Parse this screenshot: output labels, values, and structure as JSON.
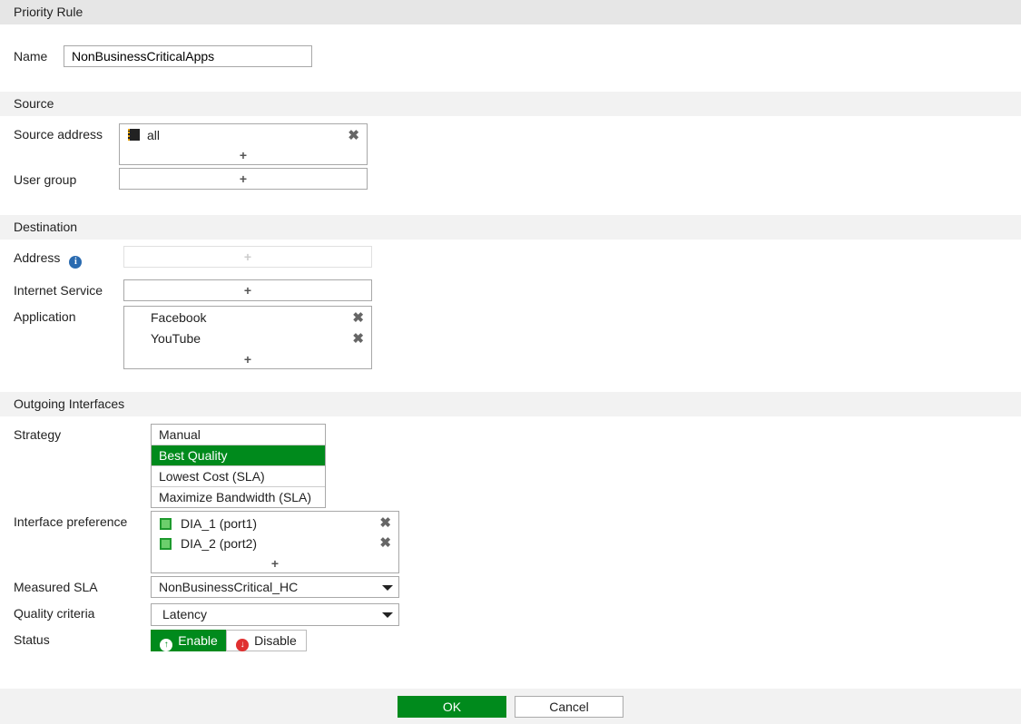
{
  "title": "Priority Rule",
  "name": {
    "label": "Name",
    "value": "NonBusinessCriticalApps"
  },
  "source": {
    "header": "Source",
    "address_label": "Source address",
    "address_items": [
      "all"
    ],
    "user_group_label": "User group"
  },
  "destination": {
    "header": "Destination",
    "address_label": "Address",
    "internet_service_label": "Internet Service",
    "application_label": "Application",
    "applications": [
      "Facebook",
      "YouTube"
    ]
  },
  "outgoing": {
    "header": "Outgoing Interfaces",
    "strategy_label": "Strategy",
    "strategies": [
      "Manual",
      "Best Quality",
      "Lowest Cost (SLA)",
      "Maximize Bandwidth (SLA)"
    ],
    "selected_strategy": "Best Quality",
    "interface_pref_label": "Interface preference",
    "interfaces": [
      "DIA_1 (port1)",
      "DIA_2 (port2)"
    ],
    "sla_label": "Measured SLA",
    "sla_value": "NonBusinessCritical_HC",
    "quality_label": "Quality criteria",
    "quality_value": "Latency",
    "status_label": "Status",
    "enable": "Enable",
    "disable": "Disable",
    "status_value": "Enable"
  },
  "footer": {
    "ok": "OK",
    "cancel": "Cancel"
  },
  "colors": {
    "accent": "#008a1c"
  }
}
